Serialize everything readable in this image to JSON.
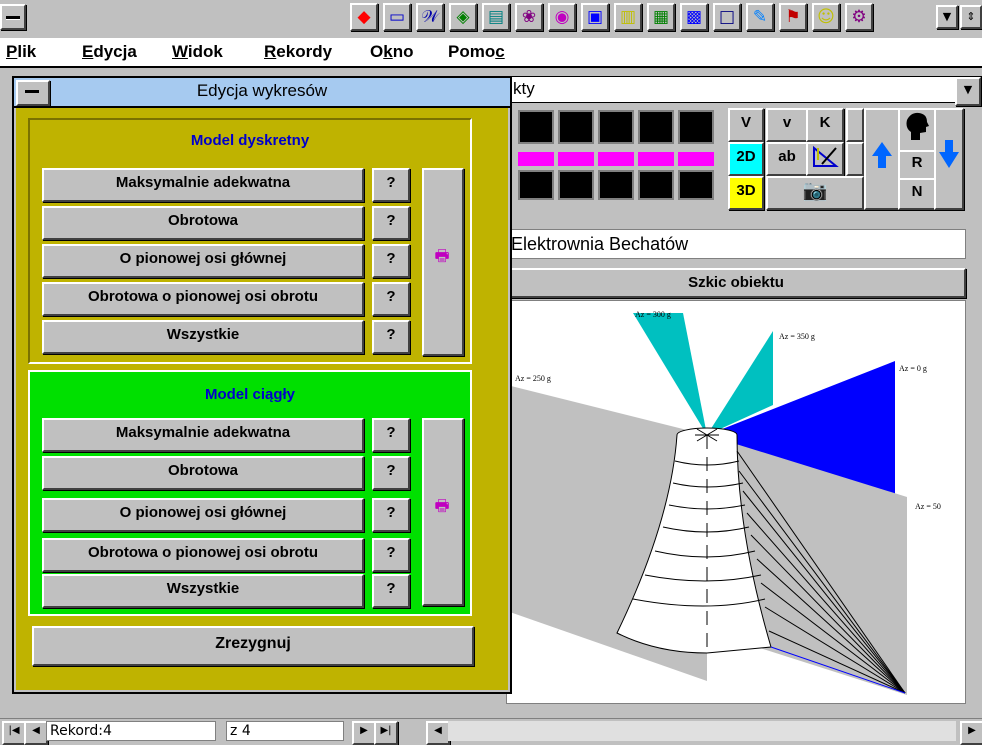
{
  "toolbar": {
    "icons": [
      "stop-icon",
      "monitor-icon",
      "text-style-icon",
      "world-icon",
      "chart-icon",
      "pattern-icon",
      "palette-icon",
      "image-icon",
      "notepad-icon",
      "grid-icon",
      "picture-icon",
      "window-icon",
      "edit-icon",
      "binoculars-icon",
      "smiley-icon",
      "settings-icon"
    ],
    "glyphs": [
      "◆",
      "▭",
      "𝒲",
      "◈",
      "▤",
      "❀",
      "◉",
      "▣",
      "▥",
      "▦",
      "▩",
      "□",
      "✎",
      "⚑",
      "☺",
      "⚙"
    ]
  },
  "menu": {
    "items": [
      {
        "label": "Plik",
        "accel": "P",
        "rest": "lik"
      },
      {
        "label": "Edycja",
        "accel": "E",
        "rest": "dycja"
      },
      {
        "label": "Widok",
        "accel": "W",
        "rest": "idok"
      },
      {
        "label": "Rekordy",
        "accel": "R",
        "rest": "ekordy"
      },
      {
        "label": "Okno",
        "pre": "O",
        "accel": "k",
        "rest": "no"
      },
      {
        "label": "Pomoc",
        "pre": "Pomo",
        "accel": "c",
        "rest": ""
      }
    ]
  },
  "background": {
    "combo_value": "kty",
    "buttons": {
      "v_upper": "V",
      "v_lower": "v",
      "k": "K",
      "d2": "2D",
      "ab": "ab",
      "d3": "3D",
      "r": "R",
      "n": "N"
    },
    "object_title": "Elektrownia Bechatów",
    "sketch_button": "Szkic obiektu",
    "sketch_labels": {
      "az300": "Az = 300 g",
      "az350": "Az = 350 g",
      "az250": "Az = 250 g",
      "az0": "Az = 0 g",
      "az50": "Az = 50"
    }
  },
  "dialog": {
    "title": "Edycja wykresów",
    "discrete": {
      "title": "Model dyskretny",
      "options": [
        "Maksymalnie adekwatna",
        "Obrotowa",
        "O pionowej osi głównej",
        "Obrotowa o pionowej osi obrotu",
        "Wszystkie"
      ]
    },
    "continuous": {
      "title": "Model ciągły",
      "options": [
        "Maksymalnie adekwatna",
        "Obrotowa",
        "O pionowej osi głównej",
        "Obrotowa o pionowej osi obrotu",
        "Wszystkie"
      ]
    },
    "help_label": "?",
    "cancel_label": "Zrezygnuj"
  },
  "status": {
    "record_label": "Rekord:",
    "record_value": "4",
    "of_label": "z",
    "of_value": "4"
  },
  "colors": {
    "dialog_title_bg": "#a6caf0",
    "discrete_bg": "#bfb300",
    "continuous_bg": "#00e000",
    "group_title": "#0000cc",
    "cyan": "#00c0c0",
    "blue": "#0000ff",
    "magenta": "#ff00ff"
  }
}
